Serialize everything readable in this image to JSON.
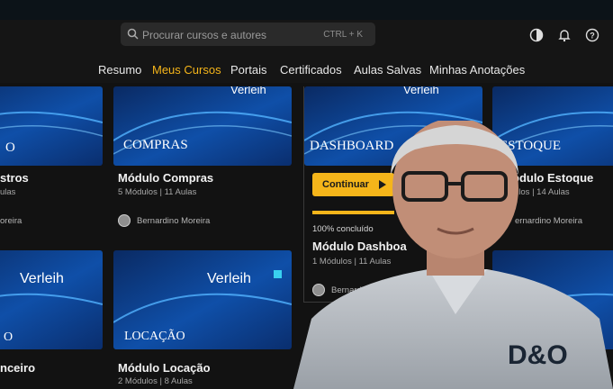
{
  "search": {
    "placeholder": "Procurar cursos e autores",
    "shortcut": "CTRL + K"
  },
  "header_icons": [
    "contrast-icon",
    "bell-icon",
    "help-icon"
  ],
  "nav": [
    {
      "label": "Resumo",
      "active": false
    },
    {
      "label": "Meus Cursos",
      "active": true
    },
    {
      "label": "Portais",
      "active": false
    },
    {
      "label": "Certificados",
      "active": false
    },
    {
      "label": "Aulas Salvas",
      "active": false
    },
    {
      "label": "Minhas Anotações",
      "active": false
    }
  ],
  "cards": [
    {
      "thumb_text": "O",
      "title": "stros",
      "meta": "ulas",
      "author": "oreira"
    },
    {
      "thumb_text": "COMPRAS",
      "title": "Módulo Compras",
      "meta": "5 Módulos | 11 Aulas",
      "author": "Bernardino Moreira"
    },
    {
      "thumb_text": "DASHBOARD",
      "title": "Módulo Dashboa",
      "meta": "1 Módulos | 11 Aulas",
      "author": "Bernardi",
      "continue_label": "Continuar",
      "progress_label": "100% concluído",
      "progress": 1.0
    },
    {
      "thumb_text": "ESTOQUE",
      "title": "ódulo Estoque",
      "meta": "ulos | 14 Aulas",
      "author": "ernardino Moreira"
    },
    {
      "thumb_text": "O",
      "title": "nceiro",
      "meta": "",
      "author": ""
    },
    {
      "thumb_text": "LOCAÇÃO",
      "title": "Módulo Locação",
      "meta": "2 Módulos | 8 Aulas",
      "author": ""
    }
  ],
  "brand_logo": "Verleih",
  "shirt_logo": "D&O",
  "colors": {
    "accent": "#f5b51a",
    "background": "#121212",
    "header": "#151515"
  }
}
